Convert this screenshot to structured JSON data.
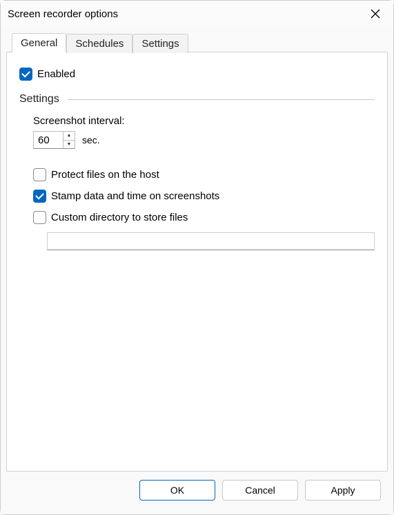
{
  "window": {
    "title": "Screen recorder options"
  },
  "tabs": [
    {
      "label": "General",
      "active": true
    },
    {
      "label": "Schedules",
      "active": false
    },
    {
      "label": "Settings",
      "active": false
    }
  ],
  "general": {
    "enabled_label": "Enabled",
    "enabled_checked": true,
    "settings_header": "Settings",
    "interval_label": "Screenshot interval:",
    "interval_value": "60",
    "interval_unit": "sec.",
    "protect_label": "Protect files on the host",
    "protect_checked": false,
    "stamp_label": "Stamp data and time on screenshots",
    "stamp_checked": true,
    "customdir_label": "Custom directory to store files",
    "customdir_checked": false,
    "customdir_value": ""
  },
  "buttons": {
    "ok": "OK",
    "cancel": "Cancel",
    "apply": "Apply"
  }
}
